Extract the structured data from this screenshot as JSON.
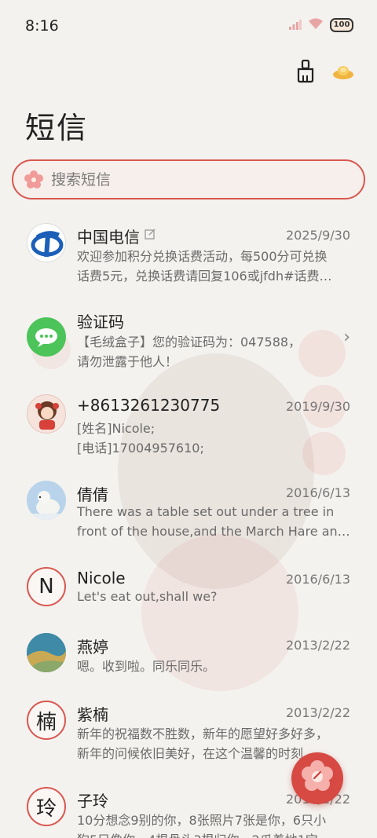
{
  "status": {
    "time": "8:16",
    "battery": "100"
  },
  "app": {
    "title": "短信"
  },
  "search": {
    "placeholder": "搜索短信"
  },
  "icons": {
    "clean": "broom-icon",
    "gold": "gold-ingot-icon",
    "search": "flower-icon",
    "fab": "compose-flower-icon"
  },
  "colors": {
    "accent": "#d8574f",
    "fab": "#d64a43"
  },
  "conversations": [
    {
      "name": "中国电信",
      "date": "2025/9/30",
      "lines": [
        "欢迎参加积分兑换话费活动，每500分可兑换",
        "话费5元，兑换话费请回复106或jfdh#话费…"
      ]
    },
    {
      "name": "验证码",
      "date": "",
      "lines": [
        "【毛绒盒子】您的验证码为：047588，",
        "请勿泄露于他人！"
      ]
    },
    {
      "name": "+8613261230775",
      "date": "2019/9/30",
      "lines": [
        "[姓名]Nicole;",
        "[电话]17004957610;"
      ]
    },
    {
      "name": "倩倩",
      "date": "2016/6/13",
      "lines": [
        "There was a table set out under a tree in",
        "front of the house,and the March Hare an…"
      ]
    },
    {
      "name": "Nicole",
      "date": "2016/6/13",
      "avatar_letter": "N",
      "lines": [
        "Let's eat out,shall we?"
      ]
    },
    {
      "name": "燕婷",
      "date": "2013/2/22",
      "lines": [
        "嗯。收到啦。同乐同乐。"
      ]
    },
    {
      "name": "紫楠",
      "date": "2013/2/22",
      "avatar_letter": "楠",
      "lines": [
        "新年的祝福数不胜数，新年的愿望好多好多，",
        "新年的问候依旧美好，在这个温馨的时刻，…"
      ]
    },
    {
      "name": "子玲",
      "date": "2013/2/22",
      "avatar_letter": "玲",
      "lines": [
        "10分想念9别的你，8张照片7张是你，6只小",
        "狗5只像你，4根骨头3根归你，2爪着地1宝"
      ]
    }
  ]
}
